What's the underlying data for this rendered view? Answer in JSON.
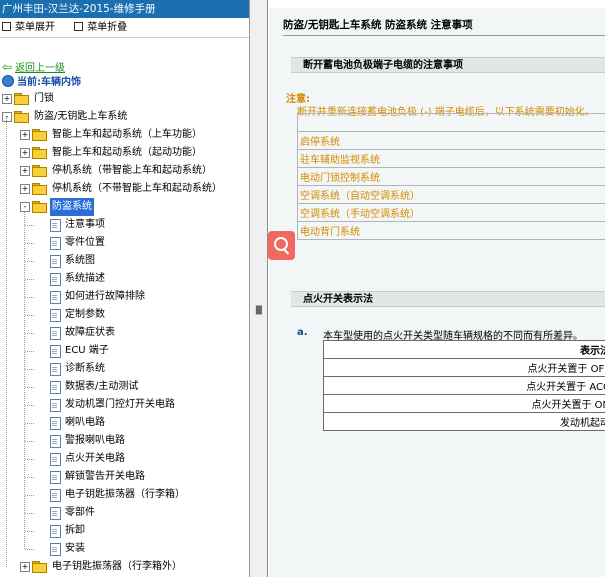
{
  "left": {
    "title": "广州丰田-汉兰达-2015-维修手册",
    "menu": {
      "expand_label": "菜单展开",
      "collapse_label": "菜单折叠"
    },
    "back_label": "返回上一级",
    "current_label": "当前:车辆内饰",
    "tree": [
      {
        "label": "门锁",
        "level": 0,
        "type": "folder",
        "toggle": "+"
      },
      {
        "label": "防盗/无钥匙上车系统",
        "level": 0,
        "type": "folder",
        "toggle": "-"
      },
      {
        "label": "智能上车和起动系统（上车功能）",
        "level": 1,
        "type": "folder",
        "toggle": "+"
      },
      {
        "label": "智能上车和起动系统（起动功能）",
        "level": 1,
        "type": "folder",
        "toggle": "+"
      },
      {
        "label": "停机系统（带智能上车和起动系统）",
        "level": 1,
        "type": "folder",
        "toggle": "+"
      },
      {
        "label": "停机系统（不带智能上车和起动系统）",
        "level": 1,
        "type": "folder",
        "toggle": "+"
      },
      {
        "label": "防盗系统",
        "level": 1,
        "type": "folder",
        "toggle": "-",
        "selected": true
      },
      {
        "label": "注意事项",
        "level": 2,
        "type": "doc"
      },
      {
        "label": "零件位置",
        "level": 2,
        "type": "doc"
      },
      {
        "label": "系统图",
        "level": 2,
        "type": "doc"
      },
      {
        "label": "系统描述",
        "level": 2,
        "type": "doc"
      },
      {
        "label": "如何进行故障排除",
        "level": 2,
        "type": "doc"
      },
      {
        "label": "定制参数",
        "level": 2,
        "type": "doc"
      },
      {
        "label": "故障症状表",
        "level": 2,
        "type": "doc"
      },
      {
        "label": "ECU 端子",
        "level": 2,
        "type": "doc"
      },
      {
        "label": "诊断系统",
        "level": 2,
        "type": "doc"
      },
      {
        "label": "数据表/主动测试",
        "level": 2,
        "type": "doc"
      },
      {
        "label": "发动机罩门控灯开关电路",
        "level": 2,
        "type": "doc"
      },
      {
        "label": "喇叭电路",
        "level": 2,
        "type": "doc"
      },
      {
        "label": "警报喇叭电路",
        "level": 2,
        "type": "doc"
      },
      {
        "label": "点火开关电路",
        "level": 2,
        "type": "doc"
      },
      {
        "label": "解锁警告开关电路",
        "level": 2,
        "type": "doc"
      },
      {
        "label": "电子钥匙振荡器（行李箱）",
        "level": 2,
        "type": "doc"
      },
      {
        "label": "零部件",
        "level": 2,
        "type": "doc"
      },
      {
        "label": "拆卸",
        "level": 2,
        "type": "doc"
      },
      {
        "label": "安装",
        "level": 2,
        "type": "doc"
      },
      {
        "label": "电子钥匙振荡器（行李箱外）",
        "level": 1,
        "type": "folder",
        "toggle": "+"
      }
    ]
  },
  "right": {
    "page_title": "防盗/无钥匙上车系统  防盗系统  注意事项",
    "section1_title": "断开蓄电池负极端子电缆的注意事项",
    "note_label": "注意:",
    "note_text": "断开并重新连接蓄电池负极 (-) 端子电缆后，以下系统需要初始化。",
    "systems": [
      "启停系统",
      "驻车辅助监视系统",
      "电动门锁控制系统",
      "空调系统（自动空调系统）",
      "空调系统（手动空调系统）",
      "电动背门系统"
    ],
    "section2_title": "点火开关表示法",
    "item_a_marker": "a.",
    "item_a_text": "本车型使用的点火开关类型随车辆规格的不同而有所差异。",
    "ig_table": {
      "header": "表示法",
      "rows": [
        "点火开关置于 OFF",
        "点火开关置于 ACC",
        "点火开关置于 ON",
        "发动机起动"
      ]
    }
  },
  "colors": {
    "title_bar": "#1a6fb0",
    "selected": "#2b6fd6",
    "note_orange": "#d48a00",
    "back_link": "#1a8f1a",
    "search_button": "#f06860"
  }
}
